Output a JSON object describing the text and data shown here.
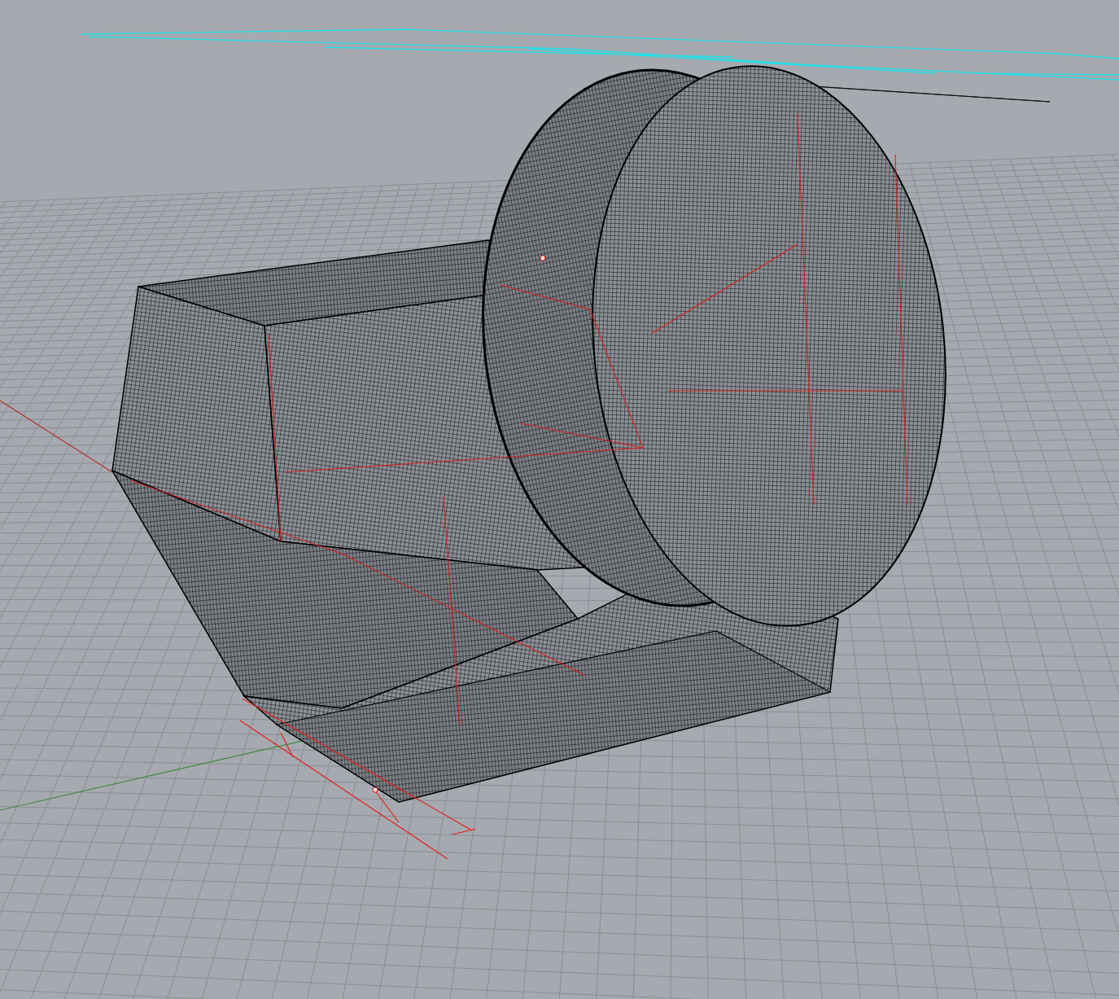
{
  "viewport": {
    "grid": true,
    "world_axes": true
  }
}
